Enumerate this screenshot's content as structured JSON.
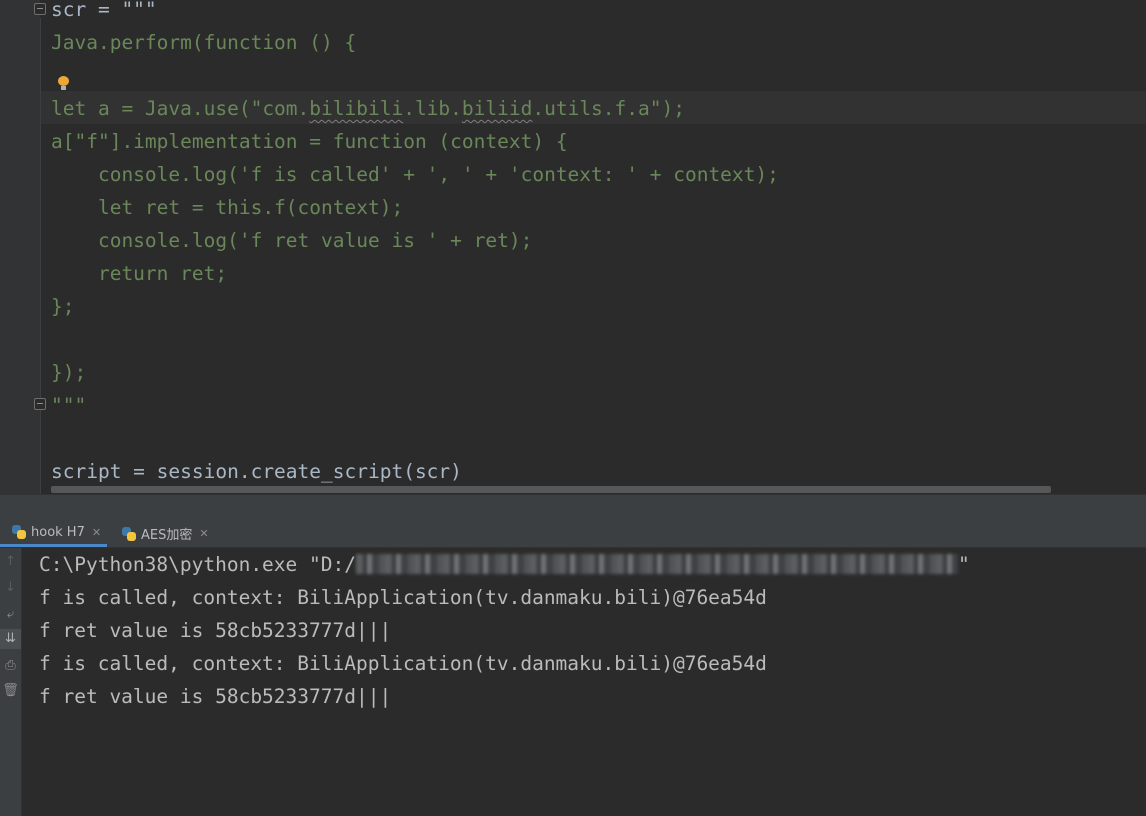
{
  "editor": {
    "lines": [
      "scr = \"\"\"",
      "Java.perform(function () {",
      "",
      "let a = Java.use(\"com.bilibili.lib.biliid.utils.f.a\");",
      "a[\"f\"].implementation = function (context) {",
      "    console.log('f is called' + ', ' + 'context: ' + context);",
      "    let ret = this.f(context);",
      "    console.log('f ret value is ' + ret);",
      "    return ret;",
      "};",
      "",
      "});",
      "\"\"\"",
      "",
      "script = session.create_script(scr)"
    ],
    "bulb_icon": "lightbulb-icon"
  },
  "tabs": [
    {
      "label": "hook H7",
      "icon": "python-icon",
      "active": true
    },
    {
      "label": "AES加密",
      "icon": "python-icon",
      "active": false
    }
  ],
  "console_toolbar": [
    "arrow-up-icon",
    "arrow-down-icon",
    "soft-wrap-icon",
    "scroll-to-end-icon",
    "print-icon",
    "trash-icon"
  ],
  "console": {
    "command_prefix": "C:\\Python38\\python.exe \"D:/",
    "command_suffix": "\"",
    "output": [
      "f is called, context: BiliApplication(tv.danmaku.bili)@76ea54d",
      "f ret value is 58cb5233777d|||",
      "f is called, context: BiliApplication(tv.danmaku.bili)@76ea54d",
      "f ret value is 58cb5233777d|||"
    ]
  },
  "colors": {
    "string_green": "#6a8759",
    "plain_text": "#a9b7c6",
    "console_text": "#bbbbbb",
    "background": "#2b2b2b",
    "tab_underline": "#4a88c7"
  }
}
